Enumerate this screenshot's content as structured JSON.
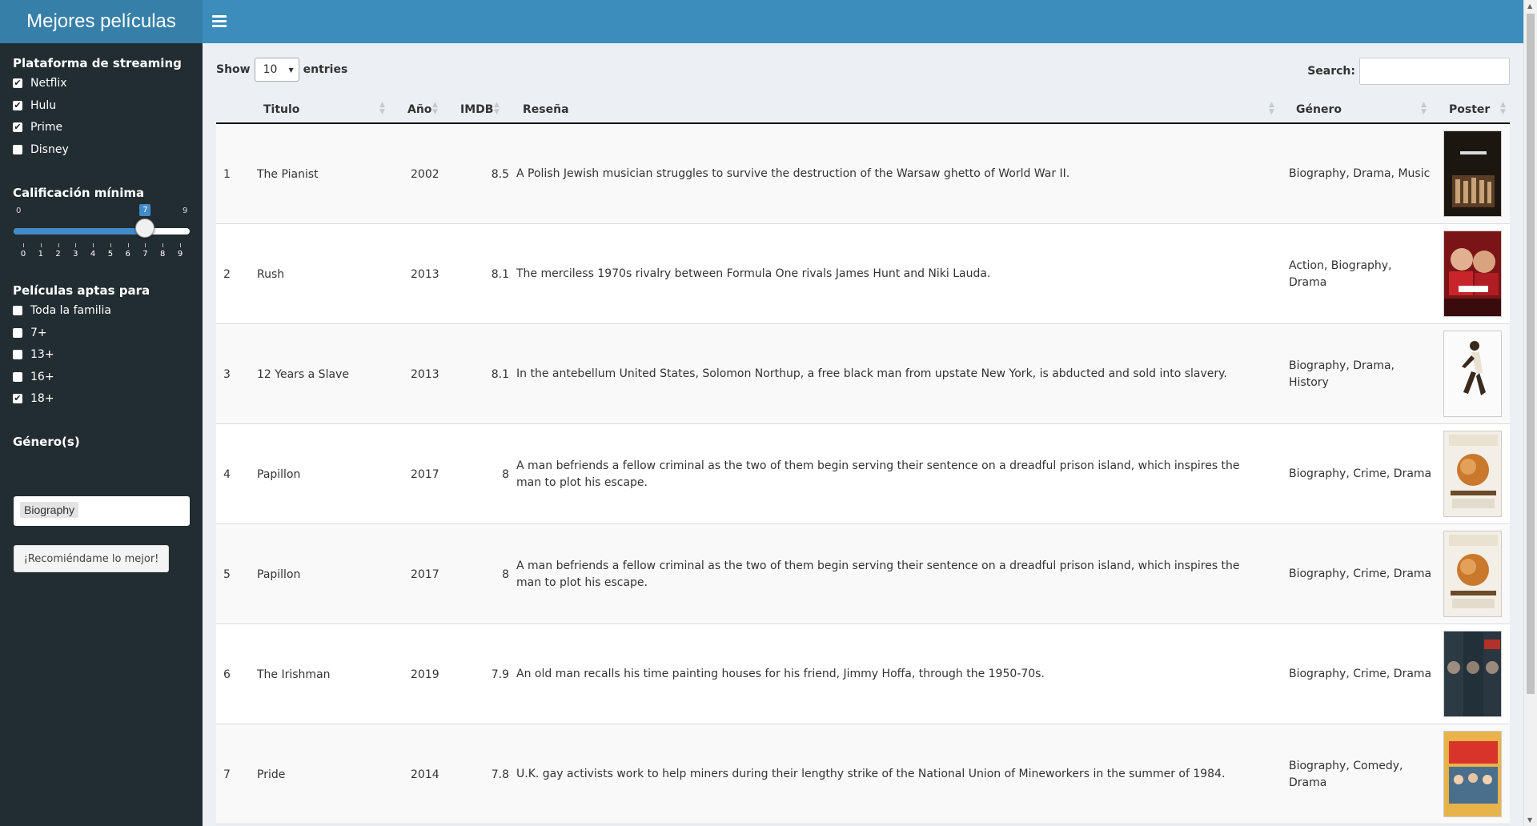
{
  "app": {
    "title": "Mejores películas"
  },
  "sidebar": {
    "platform_label": "Plataforma de streaming",
    "platforms": [
      {
        "label": "Netflix",
        "checked": true
      },
      {
        "label": "Hulu",
        "checked": true
      },
      {
        "label": "Prime",
        "checked": true
      },
      {
        "label": "Disney",
        "checked": false
      }
    ],
    "rating_label": "Calificación mínima",
    "slider": {
      "min": "0",
      "max": "9",
      "value": 7,
      "value_label": "7",
      "ticks": [
        "0",
        "1",
        "2",
        "3",
        "4",
        "5",
        "6",
        "7",
        "8",
        "9"
      ]
    },
    "age_label": "Películas aptas para",
    "ages": [
      {
        "label": "Toda la familia",
        "checked": false
      },
      {
        "label": "7+",
        "checked": false
      },
      {
        "label": "13+",
        "checked": false
      },
      {
        "label": "16+",
        "checked": false
      },
      {
        "label": "18+",
        "checked": true
      }
    ],
    "genre_label": "Género(s)",
    "genre_selected": "Biography",
    "button_label": "¡Recomiéndame lo mejor!"
  },
  "table": {
    "show_label": "Show",
    "entries_label": "entries",
    "page_size": "10",
    "search_label": "Search:",
    "columns": [
      "Titulo",
      "Año",
      "IMDB",
      "Reseña",
      "Género",
      "Poster"
    ],
    "rows": [
      {
        "n": "1",
        "title": "The Pianist",
        "year": "2002",
        "imdb": "8.5",
        "review": "A Polish Jewish musician struggles to survive the destruction of the Warsaw ghetto of World War II.",
        "genre": "Biography, Drama, Music",
        "poster": "pianist"
      },
      {
        "n": "2",
        "title": "Rush",
        "year": "2013",
        "imdb": "8.1",
        "review": "The merciless 1970s rivalry between Formula One rivals James Hunt and Niki Lauda.",
        "genre": "Action, Biography, Drama",
        "poster": "rush"
      },
      {
        "n": "3",
        "title": "12 Years a Slave",
        "year": "2013",
        "imdb": "8.1",
        "review": "In the antebellum United States, Solomon Northup, a free black man from upstate New York, is abducted and sold into slavery.",
        "genre": "Biography, Drama, History",
        "poster": "slave"
      },
      {
        "n": "4",
        "title": "Papillon",
        "year": "2017",
        "imdb": "8",
        "review": "A man befriends a fellow criminal as the two of them begin serving their sentence on a dreadful prison island, which inspires the man to plot his escape.",
        "genre": "Biography, Crime, Drama",
        "poster": "papillon"
      },
      {
        "n": "5",
        "title": "Papillon",
        "year": "2017",
        "imdb": "8",
        "review": "A man befriends a fellow criminal as the two of them begin serving their sentence on a dreadful prison island, which inspires the man to plot his escape.",
        "genre": "Biography, Crime, Drama",
        "poster": "papillon"
      },
      {
        "n": "6",
        "title": "The Irishman",
        "year": "2019",
        "imdb": "7.9",
        "review": "An old man recalls his time painting houses for his friend, Jimmy Hoffa, through the 1950-70s.",
        "genre": "Biography, Crime, Drama",
        "poster": "irishman"
      },
      {
        "n": "7",
        "title": "Pride",
        "year": "2014",
        "imdb": "7.8",
        "review": "U.K. gay activists work to help miners during their lengthy strike of the National Union of Mineworkers in the summer of 1984.",
        "genre": "Biography, Comedy, Drama",
        "poster": "pride"
      }
    ]
  },
  "colors": {
    "header": "#3c8dbc",
    "logo": "#367fa9",
    "sidebar": "#222d32",
    "accent": "#428bca"
  }
}
